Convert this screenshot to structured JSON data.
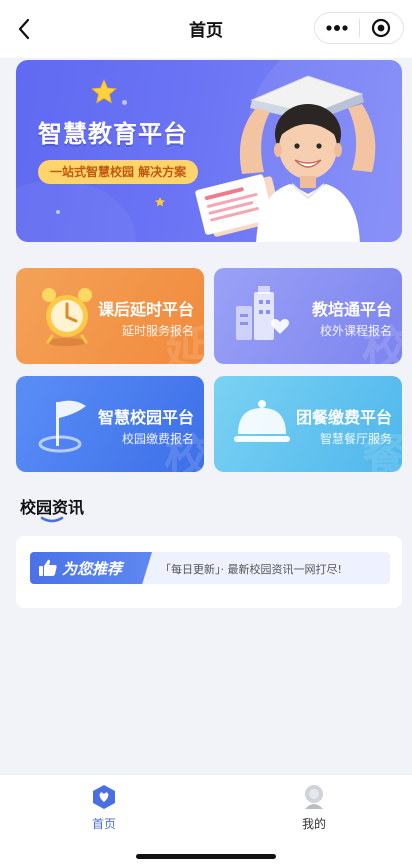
{
  "header": {
    "title": "首页",
    "back_icon": "chevron-left-icon",
    "more_icon": "more-dots-icon",
    "target_icon": "target-circle-icon"
  },
  "banner": {
    "title": "智慧教育平台",
    "subtitle": "一站式智慧校园 解决方案"
  },
  "cards": [
    {
      "title": "课后延时平台",
      "subtitle": "延时服务报名",
      "icon": "alarm-clock-icon",
      "color": "#f28a3d"
    },
    {
      "title": "教培通平台",
      "subtitle": "校外课程报名",
      "icon": "building-heart-icon",
      "color": "#7c84ef"
    },
    {
      "title": "智慧校园平台",
      "subtitle": "校园缴费报名",
      "icon": "flag-icon",
      "color": "#3d6fe8"
    },
    {
      "title": "团餐缴费平台",
      "subtitle": "智慧餐厅服务",
      "icon": "cloche-icon",
      "color": "#4fb6ec"
    }
  ],
  "news": {
    "section_title": "校园资讯",
    "badge_label": "为您推荐",
    "text": "「每日更新」· 最新校园资讯一网打尽!"
  },
  "tabbar": {
    "items": [
      {
        "label": "首页",
        "icon": "home-icon",
        "active": true
      },
      {
        "label": "我的",
        "icon": "profile-icon",
        "active": false
      }
    ]
  },
  "colors": {
    "accent": "#4a6fe3",
    "banner": "#6b74f4",
    "background": "#f1f3f9"
  }
}
